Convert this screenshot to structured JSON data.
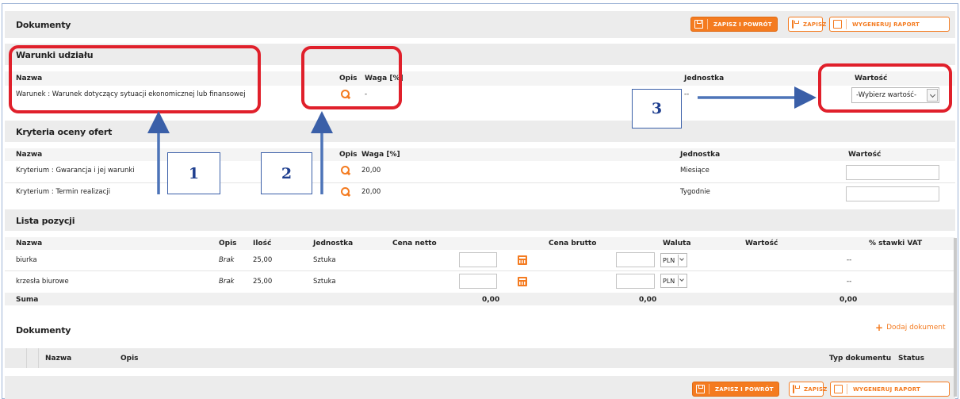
{
  "header": {
    "title": "Dokumenty",
    "buttons": {
      "save_return": "ZAPISZ I POWRÓT",
      "save": "ZAPISZ",
      "report": "WYGENERUJ RAPORT"
    }
  },
  "conditions": {
    "title": "Warunki udziału",
    "columns": {
      "name": "Nazwa",
      "desc": "Opis",
      "weight": "Waga [%]",
      "unit": "Jednostka",
      "value": "Wartość"
    },
    "row": {
      "name": "Warunek : Warunek dotyczący sytuacji ekonomicznej lub finansowej",
      "weight": "-",
      "unit": "--",
      "value": "-Wybierz wartość-"
    }
  },
  "criteria": {
    "title": "Kryteria oceny ofert",
    "columns": {
      "name": "Nazwa",
      "desc": "Opis",
      "weight": "Waga [%]",
      "unit": "Jednostka",
      "value": "Wartość"
    },
    "rows": [
      {
        "name": "Kryterium : Gwarancja i jej warunki",
        "weight": "20,00",
        "unit": "Miesiące"
      },
      {
        "name": "Kryterium : Termin realizacji",
        "weight": "20,00",
        "unit": "Tygodnie"
      }
    ]
  },
  "items": {
    "title": "Lista pozycji",
    "columns": {
      "name": "Nazwa",
      "desc": "Opis",
      "qty": "Ilość",
      "unit": "Jednostka",
      "net": "Cena netto",
      "gross": "Cena brutto",
      "currency": "Waluta",
      "value": "Wartość",
      "vat": "% stawki VAT"
    },
    "rows": [
      {
        "name": "biurka",
        "desc": "Brak",
        "qty": "25,00",
        "unit": "Sztuka",
        "currency": "PLN",
        "vat": "--"
      },
      {
        "name": "krzesła biurowe",
        "desc": "Brak",
        "qty": "25,00",
        "unit": "Sztuka",
        "currency": "PLN",
        "vat": "--"
      }
    ],
    "sum": {
      "label": "Suma",
      "net": "0,00",
      "gross": "0,00",
      "value": "0,00"
    }
  },
  "documents": {
    "title": "Dokumenty",
    "add_label": "Dodaj dokument",
    "columns": {
      "name": "Nazwa",
      "desc": "Opis",
      "type": "Typ dokumentu",
      "status": "Status"
    }
  },
  "annotations": {
    "one": "1",
    "two": "2",
    "three": "3"
  },
  "colors": {
    "accent": "#f47b20",
    "annotation_red": "#e0202b",
    "annotation_blue": "#3a5fa8",
    "section_bar": "#ececec"
  }
}
